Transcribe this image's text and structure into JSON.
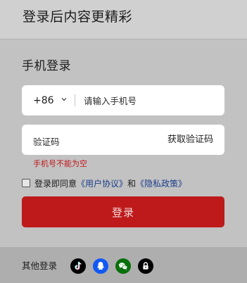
{
  "header": {
    "title": "登录后内容更精彩"
  },
  "login": {
    "section_title": "手机登录",
    "country_code": "+86",
    "phone_placeholder": "请输入手机号",
    "code_placeholder": "验证码",
    "get_code_label": "获取验证码",
    "error_message": "手机号不能为空",
    "agree_prefix": "登录即同意",
    "user_agreement": "《用户协议》",
    "agree_and": "和",
    "privacy_policy": "《隐私政策》",
    "submit_label": "登录"
  },
  "footer": {
    "other_label": "其他登录",
    "providers": [
      {
        "name": "tiktok-icon",
        "color": "#000000"
      },
      {
        "name": "qq-icon",
        "color": "#1259f4"
      },
      {
        "name": "wechat-icon",
        "color": "#08700a"
      },
      {
        "name": "lock-icon",
        "color": "#000000"
      }
    ]
  },
  "colors": {
    "primary": "#be1a1b",
    "error": "#c0171c",
    "link": "#1d3f8a"
  }
}
